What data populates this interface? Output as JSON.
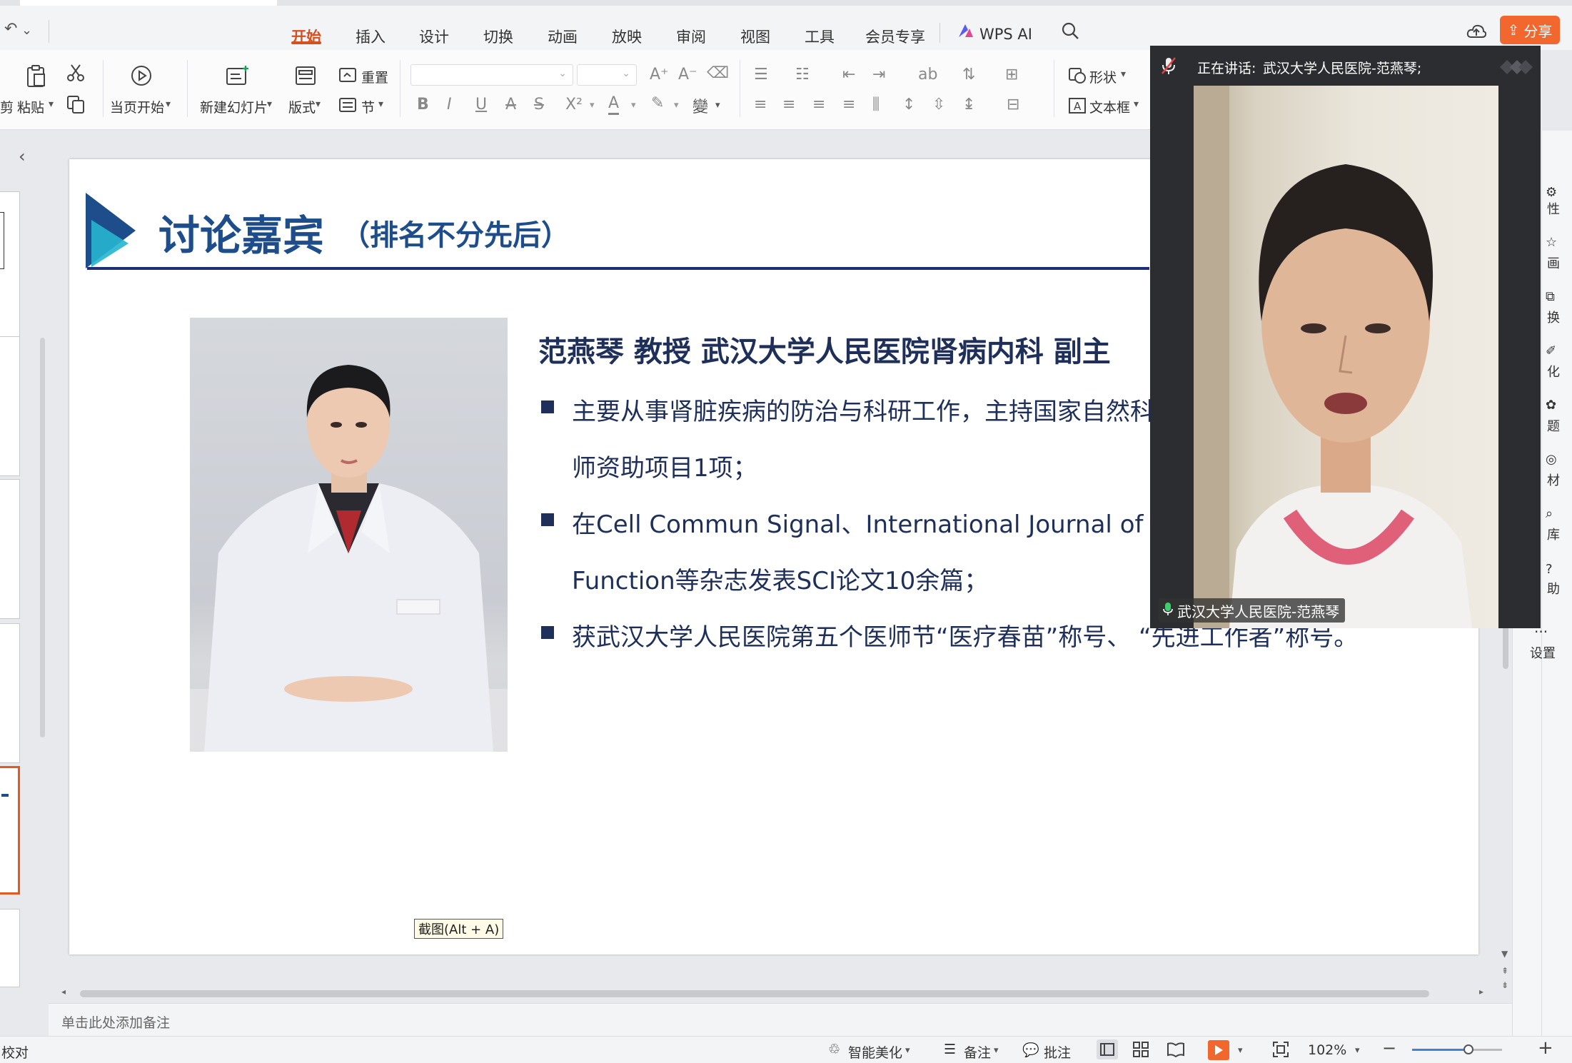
{
  "menu": {
    "tabs": [
      "开始",
      "插入",
      "设计",
      "切换",
      "动画",
      "放映",
      "审阅",
      "视图",
      "工具",
      "会员专享"
    ],
    "active_tab": "开始",
    "wps_ai": "WPS AI",
    "share": "分享"
  },
  "ribbon": {
    "cut_partial": "剪",
    "paste": "粘贴",
    "from_current": "当页开始",
    "new_slide": "新建幻灯片",
    "layout": "版式",
    "reset": "重置",
    "section": "节",
    "shape": "形状",
    "textbox": "文本框"
  },
  "slide": {
    "title": "讨论嘉宾",
    "subtitle": "（排名不分先后）",
    "guest_heading": "范燕琴   教授    武汉大学人民医院肾病内科   副主",
    "bullets": [
      {
        "lines": [
          "主要从事肾脏疾病的防治与科研工作，主持国家自然科学",
          "师资助项目1项；"
        ]
      },
      {
        "lines": [
          "在Cell Commun Signal、International Journal of Bio",
          "Function等杂志发表SCI论文10余篇；"
        ]
      },
      {
        "lines": [
          "获武汉大学人民医院第五个医师节“医疗春苗”称号、  “先进工作者”称号。"
        ]
      }
    ]
  },
  "snip_tooltip": "截图(Alt + A)",
  "notes_placeholder": "单击此处添加备注",
  "status": {
    "proofread": "校对",
    "beautify": "智能美化",
    "notes": "备注",
    "comment": "批注",
    "zoom": "102%"
  },
  "right_panel": [
    "性",
    "画",
    "换",
    "化",
    "题",
    "材",
    "库",
    "助",
    "设置"
  ],
  "video": {
    "speaking_label": "正在讲话:",
    "speaking_name": "武汉大学人民医院-范燕琴;",
    "participant_name": "武汉大学人民医院-范燕琴"
  },
  "colors": {
    "accent_orange": "#d4511f",
    "share_bg": "#f1672e",
    "title_blue": "#1e4d8c",
    "body_navy": "#1e2f5a",
    "rule_navy": "#1e2f78",
    "logo_teal": "#26b5d0"
  }
}
